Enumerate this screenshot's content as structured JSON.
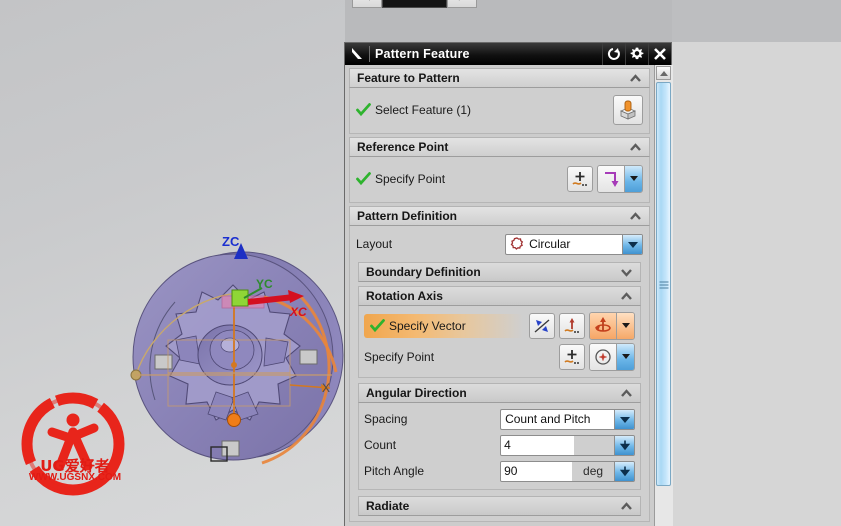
{
  "app": {
    "viewport_labels": {
      "zc_axis": "ZC",
      "yc_axis": "YC",
      "xc_axis": "XC",
      "x_axis": "X"
    },
    "watermark": {
      "brand": "UG爱好者",
      "url": "WWW.UGSNX.COM"
    }
  },
  "top_widget": {
    "left_button_icon": "left-arrow-icon",
    "right_button_icon": "right-arrow-icon",
    "field_value": ""
  },
  "dialog": {
    "title": "Pattern Feature",
    "menu_icon": "dialog-menu-arrow-icon",
    "titlebar_buttons": [
      {
        "name": "reset-button",
        "icon": "reset-circular-arrow-icon"
      },
      {
        "name": "settings-button",
        "icon": "gear-icon"
      },
      {
        "name": "close-button",
        "icon": "close-x-icon"
      }
    ],
    "sections": {
      "feature_to_pattern": {
        "header": "Feature to Pattern",
        "collapse_icon": "chevron-up-icon",
        "select_feature": {
          "label": "Select Feature (1)",
          "status_icon": "green-check-icon",
          "button_icon": "select-feature-icon"
        }
      },
      "reference_point": {
        "header": "Reference Point",
        "collapse_icon": "chevron-up-icon",
        "specify_point": {
          "label": "Specify Point",
          "status_icon": "green-check-icon",
          "point_dialog_icon": "point-constructor-icon",
          "point_type_icon": "inferred-point-icon",
          "dropdown_icon": "chevron-down-icon"
        }
      },
      "pattern_definition": {
        "header": "Pattern Definition",
        "collapse_icon": "chevron-up-icon",
        "layout": {
          "label": "Layout",
          "value": "Circular",
          "value_icon": "circular-pattern-icon",
          "dropdown_icon": "chevron-down-icon"
        },
        "boundary_definition": {
          "header": "Boundary Definition",
          "collapse_icon": "chevron-down-icon"
        },
        "rotation_axis": {
          "header": "Rotation Axis",
          "collapse_icon": "chevron-up-icon",
          "specify_vector": {
            "label": "Specify Vector",
            "status_icon": "green-check-icon",
            "highlighted": true,
            "reverse_icon": "reverse-direction-icon",
            "vector_dialog_icon": "vector-constructor-icon",
            "vector_type_icon": "rotation-vector-icon",
            "dropdown_icon": "chevron-down-icon"
          },
          "specify_point": {
            "label": "Specify Point",
            "point_dialog_icon": "point-constructor-icon",
            "point_type_icon": "arc-center-point-icon",
            "dropdown_icon": "chevron-down-icon"
          }
        },
        "angular_direction": {
          "header": "Angular Direction",
          "collapse_icon": "chevron-up-icon",
          "spacing": {
            "label": "Spacing",
            "value": "Count and Pitch",
            "dropdown_icon": "chevron-down-icon"
          },
          "count": {
            "label": "Count",
            "value": "4",
            "spinner_icon": "spinner-down-icon"
          },
          "pitch_angle": {
            "label": "Pitch Angle",
            "value": "90",
            "unit": "deg",
            "spinner_icon": "spinner-down-icon"
          }
        },
        "radiate": {
          "header": "Radiate",
          "collapse_icon": "chevron-up-icon"
        }
      }
    },
    "scrollbar": {
      "up_arrow_icon": "scroll-up-arrow-icon",
      "thumb_grip_icon": "scrollbar-grip-icon"
    }
  },
  "colors": {
    "accent_blue": "#4e9fd8",
    "highlight_orange": "#f0a64e",
    "check_green": "#2eb32e",
    "dialog_bg": "#cccccc",
    "titlebar_bg": "#101010",
    "watermark_red": "#e11b14"
  }
}
